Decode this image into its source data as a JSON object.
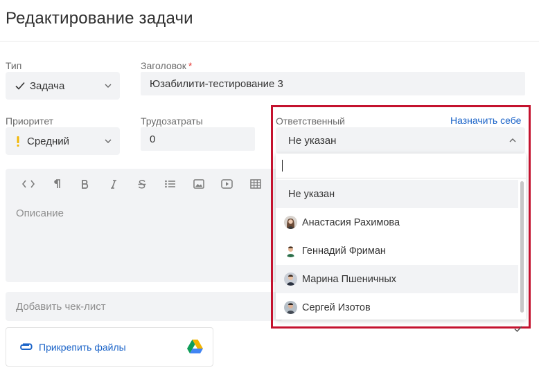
{
  "page": {
    "title": "Редактирование задачи"
  },
  "type_field": {
    "label": "Тип",
    "value": "Задача"
  },
  "title_field": {
    "label": "Заголовок",
    "required_mark": "*",
    "value": "Юзабилити-тестирование 3"
  },
  "priority_field": {
    "label": "Приоритет",
    "value": "Средний",
    "indicator_color": "#f2b705"
  },
  "effort_field": {
    "label": "Трудозатраты",
    "value": "0"
  },
  "assignee_field": {
    "label": "Ответственный",
    "assign_self_link": "Назначить себе",
    "value": "Не указан",
    "search_value": "",
    "options": [
      {
        "label": "Не указан",
        "avatar": null,
        "highlighted": true
      },
      {
        "label": "Анастасия Рахимова",
        "avatar": "avatar-woman-icon"
      },
      {
        "label": "Геннадий Фриман",
        "avatar": "avatar-man-icon"
      },
      {
        "label": "Марина Пшеничных",
        "avatar": "avatar-man-icon",
        "highlighted": true
      },
      {
        "label": "Сергей Изотов",
        "avatar": "avatar-man-icon"
      }
    ]
  },
  "editor": {
    "placeholder": "Описание",
    "toolbar": [
      "code-icon",
      "paragraph-icon",
      "bold-icon",
      "italic-icon",
      "strikethrough-icon",
      "list-icon",
      "image-icon",
      "video-icon",
      "table-icon"
    ]
  },
  "checklist": {
    "placeholder": "Добавить чек-лист"
  },
  "attachments": {
    "label": "Прикрепить файлы",
    "icons": [
      "paperclip-icon",
      "google-drive-icon"
    ]
  },
  "colors": {
    "link": "#1a63c8",
    "highlight_border": "#c4122e",
    "field_bg": "#f2f3f5"
  }
}
